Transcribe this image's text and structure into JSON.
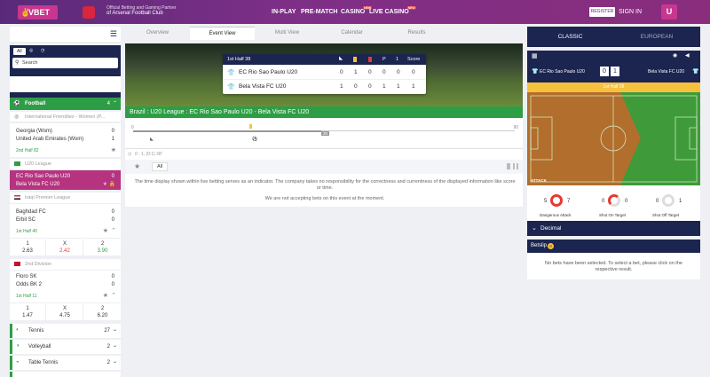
{
  "header": {
    "logo": "VBET",
    "partner_line1": "Official Betting and Gaming Partner",
    "partner_line2": "of Arsenal Football Club",
    "nav": [
      "IN-PLAY",
      "PRE-MATCH",
      "CASINO",
      "LIVE CASINO"
    ],
    "new_badge": "NEW",
    "register": "REGISTER",
    "sign_in": "SIGN IN",
    "user_icon": "U"
  },
  "left": {
    "filter_all": "All",
    "search_placeholder": "Search",
    "favourites": "Favourites",
    "favourites_count": "0",
    "football": "Football",
    "football_count": "4",
    "leagues": [
      {
        "name": "International Friendlies - Women (P...",
        "matches": [
          {
            "home": "Georgia (Wom)",
            "away": "United Arab Emirates (Wom)",
            "home_score": "0",
            "away_score": "1",
            "status": "2nd Half 82"
          }
        ]
      },
      {
        "name": "U20 League",
        "matches": [
          {
            "home": "EC Rio Sao Paulo U20",
            "away": "Bela Vista FC U20",
            "home_score": "0",
            "away_score": "1",
            "status": ""
          }
        ]
      },
      {
        "name": "Iraqi Premier League",
        "matches": [
          {
            "home": "Baghdad FC",
            "away": "Erbil SC",
            "home_score": "0",
            "away_score": "0",
            "status": "1st Half 40",
            "odds": [
              {
                "label": "1",
                "value": "2.63"
              },
              {
                "label": "X",
                "value": "2.42"
              },
              {
                "label": "2",
                "value": "3.90"
              }
            ]
          }
        ]
      },
      {
        "name": "2nd Division",
        "matches": [
          {
            "home": "Floro SK",
            "away": "Odds BK 2",
            "home_score": "0",
            "away_score": "0",
            "status": "1st Half 11",
            "odds": [
              {
                "label": "1",
                "value": "1.47"
              },
              {
                "label": "X",
                "value": "4.75"
              },
              {
                "label": "2",
                "value": "6.20"
              }
            ]
          }
        ]
      }
    ],
    "sports": [
      {
        "name": "Tennis",
        "count": "27"
      },
      {
        "name": "Volleyball",
        "count": "2"
      },
      {
        "name": "Table Tennis",
        "count": "2"
      }
    ]
  },
  "center": {
    "tabs": [
      "Overview",
      "Event View",
      "Multi View",
      "Calendar",
      "Results"
    ],
    "scoreboard": {
      "period": "1st Half 38",
      "col_headers": [
        "P",
        "1",
        "Score"
      ],
      "home": {
        "name": "EC Rio Sao Paulo U20",
        "values": [
          "0",
          "1",
          "0",
          "0",
          "0",
          "0"
        ]
      },
      "away": {
        "name": "Bela Vista FC U20",
        "values": [
          "1",
          "0",
          "0",
          "1",
          "1",
          "1"
        ]
      }
    },
    "event_title": "Brazil : U20 League : EC Rio Sao Paulo U20 - Bela Vista FC U20",
    "timeline": {
      "start": "0",
      "end": "90",
      "marker": "38",
      "caption": "0 : 1, (0:1) 38'"
    },
    "market_filter": "All",
    "notice1": "The time display shown within live betting serves as an indicator. The company takes no responsibility for the correctness and currentness of the displayed information like score or time.",
    "notice2": "We are not accepting bets on this event at the moment."
  },
  "right": {
    "tabs": [
      "CLASSIC",
      "EUROPEAN"
    ],
    "home": "EC Rio Sao Paulo U20",
    "away": "Bela Vista FC U20",
    "home_score": "0",
    "away_score": "1",
    "period": "1st Half 38",
    "pitch_label": "ATTACK",
    "stats": [
      {
        "label": "Dangerous Attack",
        "home": "5",
        "away": "7"
      },
      {
        "label": "Shot On Target",
        "home": "0",
        "away": "0"
      },
      {
        "label": "Shot Off Target",
        "home": "0",
        "away": "1"
      }
    ],
    "odds_format": "Decimal",
    "betslip": "Betslip",
    "betslip_count": "0",
    "betslip_empty": "No bets have been selected. To select a bet, please click on the respective result."
  },
  "colors": {
    "purple": "#7d2f86",
    "navy": "#1b2550",
    "green": "#2e9e46",
    "pink": "#c8368f",
    "yellow": "#f6c23e"
  }
}
